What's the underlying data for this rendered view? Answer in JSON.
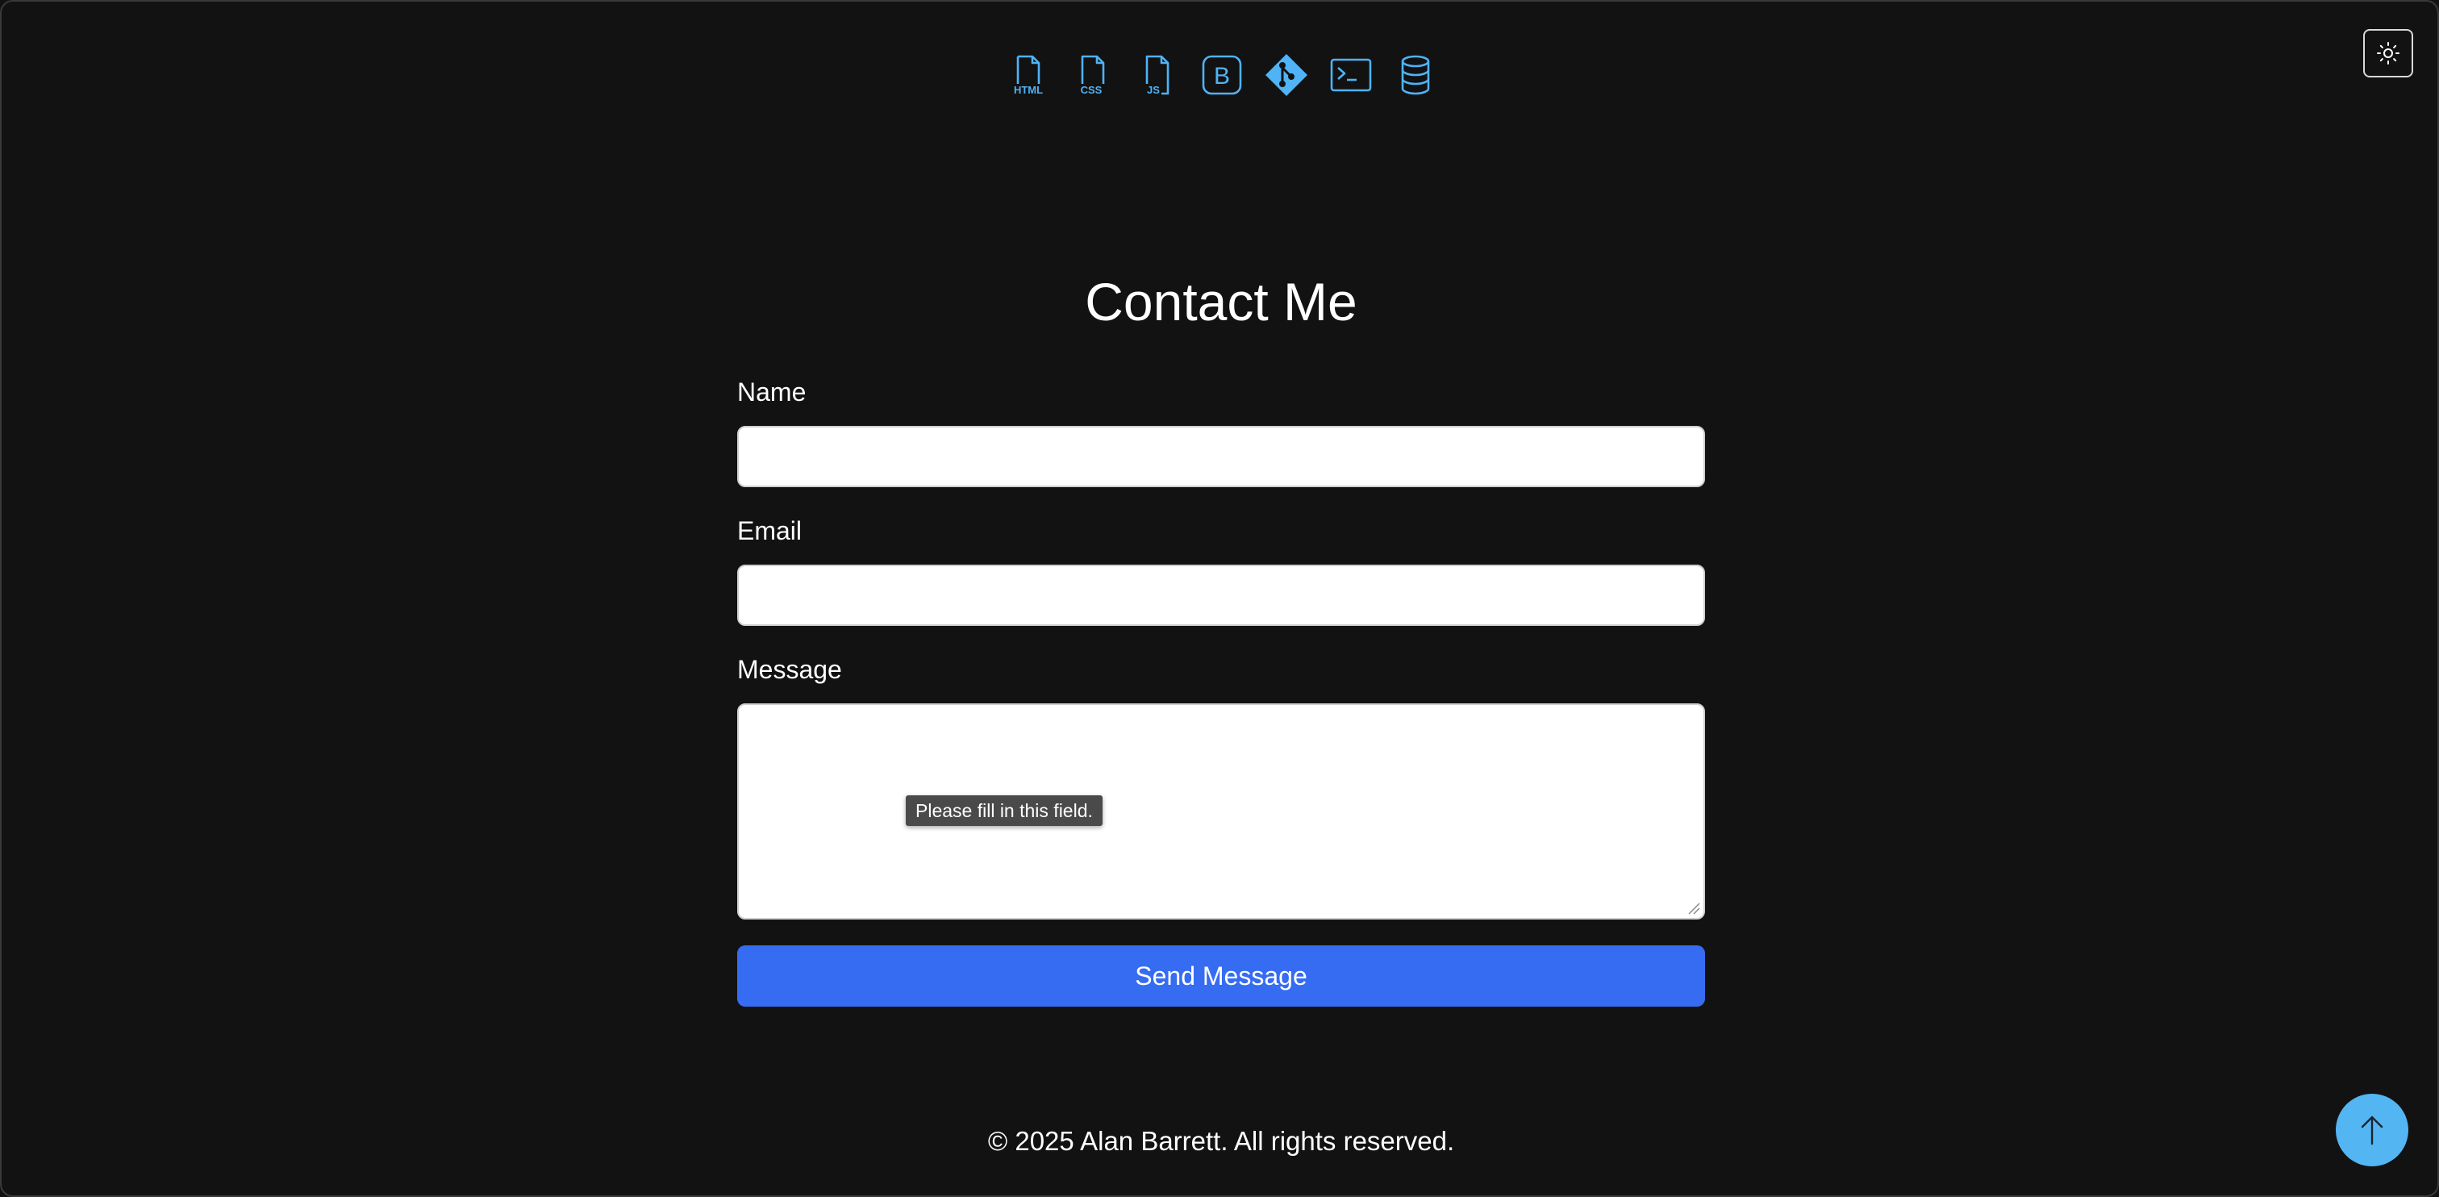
{
  "colors": {
    "background": "#121212",
    "icon_accent": "#4fb3f6",
    "button_primary": "#356cf2",
    "scroll_top_bg": "#54b5f3",
    "tooltip_bg": "#4a4a4a"
  },
  "tech_icons": [
    {
      "name": "html-file-icon",
      "label": "HTML"
    },
    {
      "name": "css-file-icon",
      "label": "CSS"
    },
    {
      "name": "js-file-icon",
      "label": "JS"
    },
    {
      "name": "bootstrap-icon",
      "label": "B"
    },
    {
      "name": "git-icon",
      "label": ""
    },
    {
      "name": "terminal-icon",
      "label": ""
    },
    {
      "name": "database-icon",
      "label": ""
    }
  ],
  "theme_toggle": {
    "icon": "sun-icon"
  },
  "contact": {
    "title": "Contact Me",
    "name_label": "Name",
    "name_value": "",
    "email_label": "Email",
    "email_value": "",
    "message_label": "Message",
    "message_value": "",
    "validation_tooltip": "Please fill in this field.",
    "submit_label": "Send Message"
  },
  "footer": {
    "copyright": "© 2025 Alan Barrett. All rights reserved."
  },
  "scroll_top": {
    "icon": "arrow-up-icon"
  }
}
